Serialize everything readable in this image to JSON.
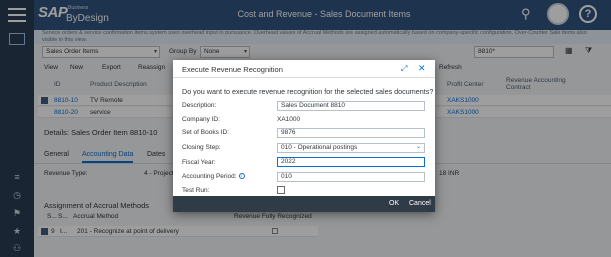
{
  "shell": {
    "logo": "SAP",
    "product": "ByDesign",
    "logo_tag": "Business",
    "title": "Cost and Revenue - Sales Document Items"
  },
  "background": {
    "info_text": "Service orders & service confirmation items system uses overhead input in pursuance. Overhead values of Accrual Methods are assigned automatically based on company-specific configuration. Over-Counter Sale items also visible in this view.",
    "view_select": "Sales Order Items",
    "group_by_label": "Group By",
    "group_by_value": "None",
    "search_value": "8810*",
    "toolbar": [
      "View",
      "New",
      "Export",
      "Reassign",
      "Refresh"
    ],
    "columns": [
      "ID",
      "Product Description",
      "Profit Center",
      "Revenue Accounting Contract"
    ],
    "rows": [
      {
        "id": "8810-10",
        "desc": "TV Remote",
        "profit_center": "XAKS1000"
      },
      {
        "id": "8810-20",
        "desc": "service",
        "profit_center": "XAKS1000"
      }
    ],
    "details_title": "Details: Sales Order Item 8810-10",
    "tabs": [
      "General",
      "Accounting Data",
      "Dates"
    ],
    "revenue_type_label": "Revenue Type:",
    "revenue_type_value": "4 - Project Sa",
    "right_value": "18 INR",
    "accrual_title": "Assignment of Accrual Methods",
    "accrual_cols": [
      "S...",
      "S...",
      "Accrual Method",
      "Revenue Fully Recognized"
    ],
    "accrual_row": {
      "c1": "9",
      "c2": "I...",
      "method": "201 - Recognize at point of delivery"
    }
  },
  "dialog": {
    "title": "Execute Revenue Recognition",
    "question": "Do you want to execute revenue recognition for the selected sales documents?",
    "fields": {
      "description_label": "Description:",
      "description_value": "Sales Document 8810",
      "company_label": "Company ID:",
      "company_value": "XA1000",
      "books_label": "Set of Books ID:",
      "books_value": "9876",
      "closing_label": "Closing Step:",
      "closing_value": "010 - Operational postings",
      "fiscal_label": "Fiscal Year:",
      "fiscal_value": "2022",
      "period_label": "Accounting Period:",
      "period_value": "010",
      "testrun_label": "Test Run:"
    },
    "ok_label": "OK",
    "cancel_label": "Cancel"
  }
}
